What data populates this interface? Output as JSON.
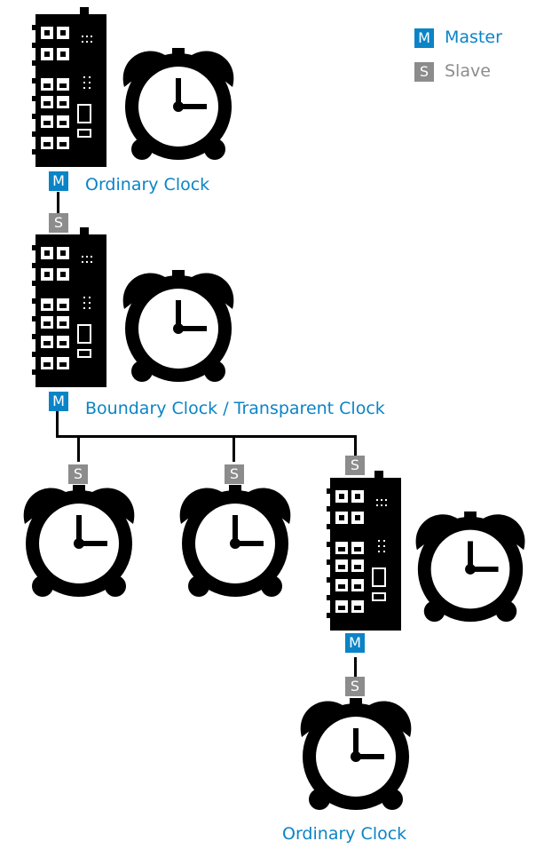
{
  "colors": {
    "master": "#0a84c6",
    "slave": "#8c8c8c",
    "label": "#0a84c6"
  },
  "legend": {
    "master": {
      "letter": "M",
      "text": "Master"
    },
    "slave": {
      "letter": "S",
      "text": "Slave"
    }
  },
  "badges": {
    "master": "M",
    "slave": "S"
  },
  "labels": {
    "ordinary_top": "Ordinary Clock",
    "boundary": "Boundary Clock / Transparent Clock",
    "ordinary_bottom": "Ordinary Clock"
  },
  "icons": {
    "switch": "industrial-ethernet-switch-icon",
    "clock": "alarm-clock-icon"
  }
}
